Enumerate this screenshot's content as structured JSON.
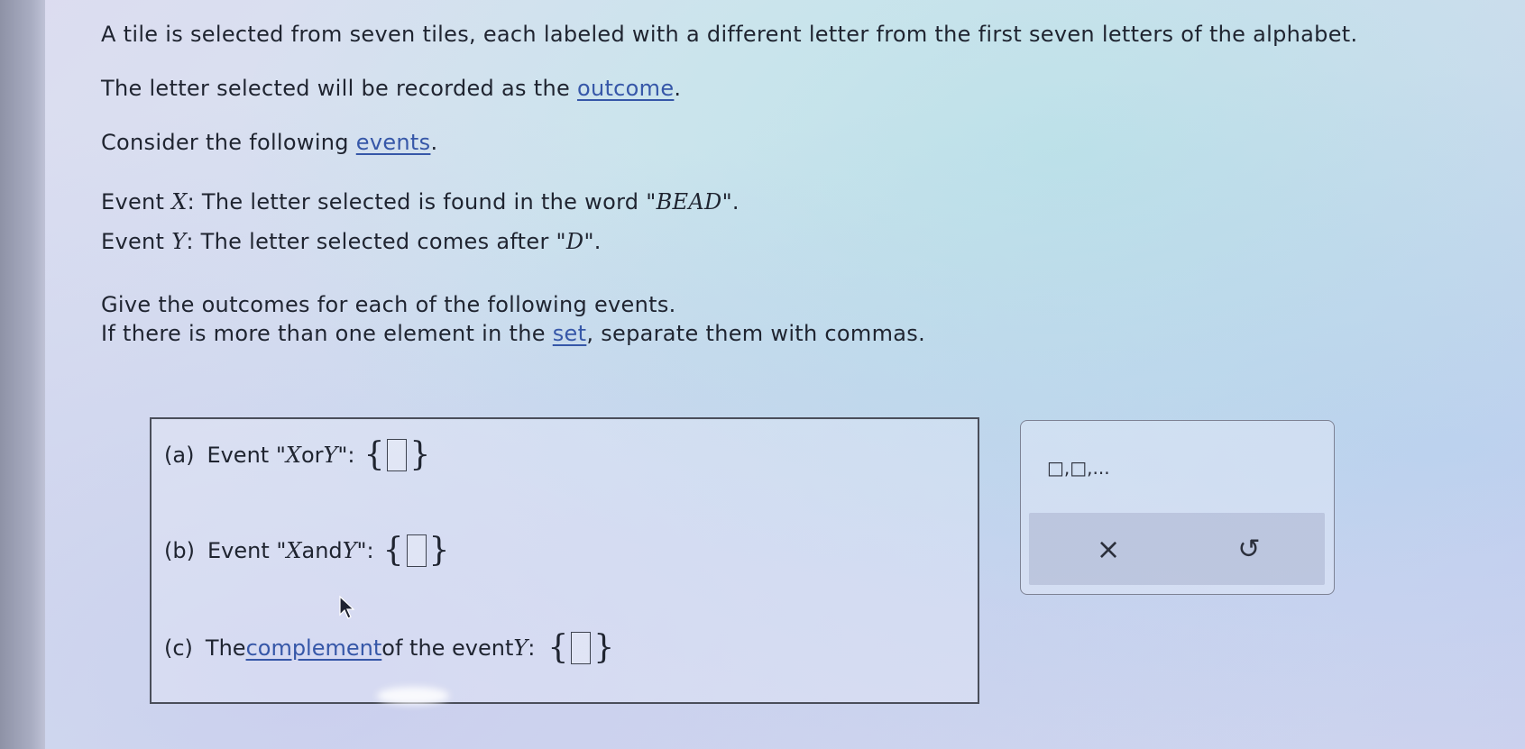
{
  "problem": {
    "line1": "A tile is selected from seven tiles, each labeled with a different letter from the first seven letters of the alphabet.",
    "line2_pre": "The letter selected will be recorded as the ",
    "line2_link": "outcome",
    "line2_post": ".",
    "line3_pre": "Consider the following ",
    "line3_link": "events",
    "line3_post": ".",
    "eventX_label": "Event ",
    "eventX_var": "X",
    "eventX_text": ": The letter selected is found in the word \"",
    "eventX_word": "BEAD",
    "eventX_end": "\".",
    "eventY_label": "Event ",
    "eventY_var": "Y",
    "eventY_text": ": The letter selected comes after \"",
    "eventY_letter": "D",
    "eventY_end": "\".",
    "instr1": "Give the outcomes for each of the following events.",
    "instr2_pre": "If there is more than one element in the ",
    "instr2_link": "set",
    "instr2_post": ", separate them with commas."
  },
  "parts": {
    "a": {
      "label": "(a)",
      "pre": "Event \"",
      "v1": "X",
      "mid": " or ",
      "v2": "Y",
      "post": "\":"
    },
    "b": {
      "label": "(b)",
      "pre": "Event \"",
      "v1": "X",
      "mid": " and ",
      "v2": "Y",
      "post": "\":"
    },
    "c": {
      "label": "(c)",
      "pre": "The ",
      "link": "complement",
      "mid": " of the event ",
      "v1": "Y",
      "post": ":"
    }
  },
  "braces": {
    "open": "{",
    "close": "}"
  },
  "keypad": {
    "template": "□,□,...",
    "clear_symbol": "×",
    "undo_symbol": "↺"
  }
}
